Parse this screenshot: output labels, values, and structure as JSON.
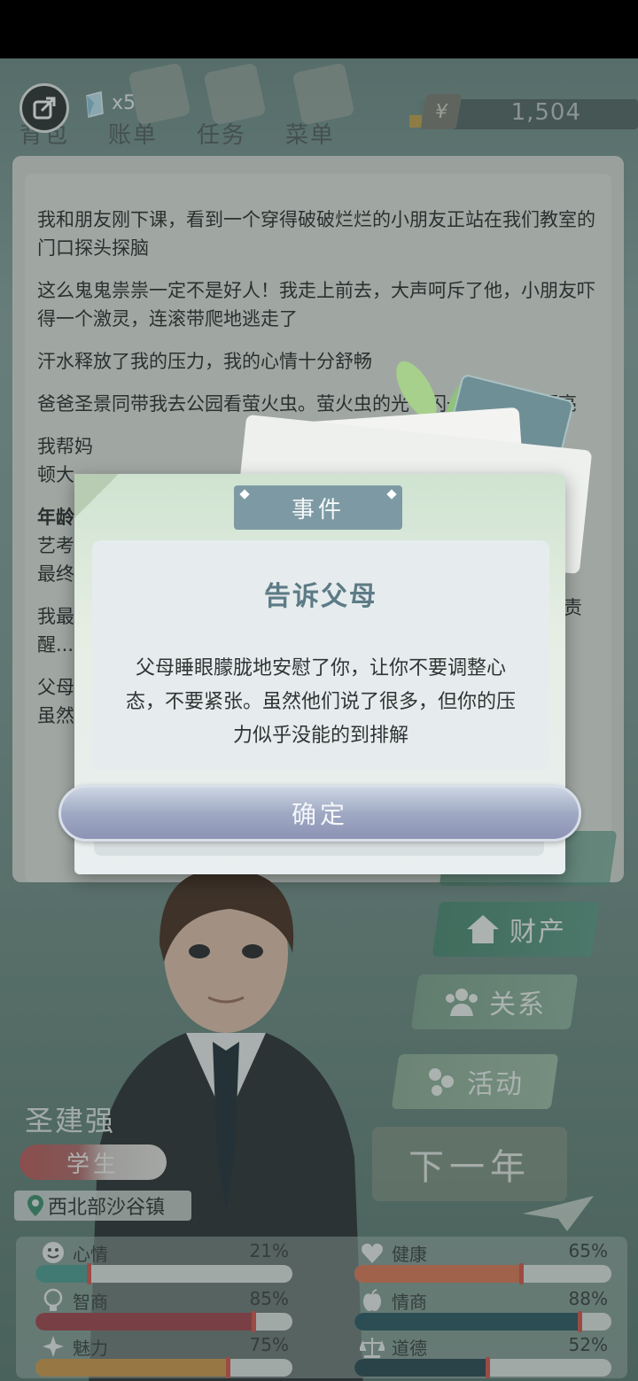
{
  "top_nav": {
    "items": [
      "背包",
      "账单",
      "任务",
      "菜单"
    ],
    "gem_count": "x5",
    "currency_symbol": "¥",
    "money": "1,504"
  },
  "journal": {
    "paragraphs": [
      "我和朋友刚下课，看到一个穿得破破烂烂的小朋友正站在我们教室的门口探头探脑",
      "这么鬼鬼祟祟一定不是好人！我走上前去，大声呵斥了他，小朋友吓得一个激灵，连滚带爬地逃走了",
      "汗水释放了我的压力，我的心情十分舒畅",
      "爸爸圣景同带我去公园看萤火虫。萤火虫的光一闪一闪的，真漂亮",
      "我帮妈",
      "顿大",
      "年龄",
      "艺考",
      "最终",
      "我最",
      "醒...",
      "父母",
      "虽然"
    ],
    "right_edge_fragments": [
      "责"
    ]
  },
  "modal": {
    "tab": "事件",
    "title": "告诉父母",
    "description": "父母睡眼朦胧地安慰了你，让你不要调整心态，不要紧张。虽然他们说了很多，但你的压力似乎没能的到排解",
    "confirm": "确定"
  },
  "side_buttons": {
    "assets": "财产",
    "relations": "关系",
    "activities": "活动",
    "next_year": "下一年"
  },
  "character": {
    "name": "圣建强",
    "role": "学生",
    "location": "西北部沙谷镇"
  },
  "stats": [
    {
      "name": "心情",
      "pct": "21%",
      "value": 0.21,
      "color": "#4f9e93",
      "icon": "smiley-icon"
    },
    {
      "name": "健康",
      "pct": "65%",
      "value": 0.65,
      "color": "#e07a55",
      "icon": "heart-icon"
    },
    {
      "name": "智商",
      "pct": "85%",
      "value": 0.85,
      "color": "#a3454d",
      "icon": "bulb-icon"
    },
    {
      "name": "情商",
      "pct": "88%",
      "value": 0.88,
      "color": "#2f5a63",
      "icon": "apple-icon"
    },
    {
      "name": "魅力",
      "pct": "75%",
      "value": 0.75,
      "color": "#d39a4c",
      "icon": "sparkle-icon"
    },
    {
      "name": "道德",
      "pct": "52%",
      "value": 0.52,
      "color": "#2b4b54",
      "icon": "scale-icon"
    }
  ]
}
